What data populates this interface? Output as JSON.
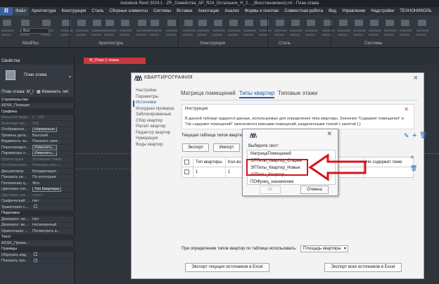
{
  "app": {
    "title": "Autodesk Revit 2024.1 - ZR_Семейства_АР_R24_Остальное_Н_2..._(Восстановлено).rvt - План этажа"
  },
  "menu": [
    "Файл",
    "Архитектура",
    "Конструкция",
    "Сталь",
    "Сборные элементы",
    "Системы",
    "Вставка",
    "Аннотации",
    "Анализ",
    "Формы и генплан",
    "Совместная работа",
    "Вид",
    "Управление",
    "Надстройки",
    "ТЕХНОНИКОЛЬ"
  ],
  "ribbon": {
    "panels": [
      "ModPlus",
      "Архитектура",
      "Конструкции",
      "Сталь",
      "Системы"
    ],
    "dropdown_value": "Все"
  },
  "view_tab": {
    "label": "М_План 1 этажа"
  },
  "left_panel": {
    "title": "Свойства",
    "type_name": "План этажа",
    "plan_selector": "План этажа: М_І",
    "edit_type_label": "Изменить тип",
    "rows": [
      {
        "k": "Строительство",
        "v": "",
        "hdr": true
      },
      {
        "k": "ADSK_Позиция",
        "v": ""
      },
      {
        "k": "Графика",
        "v": "",
        "hdr": true
      },
      {
        "k": "Масштаб вида",
        "v": "1 : 100"
      },
      {
        "k": "Значение ма...",
        "v": "100"
      },
      {
        "k": "Отображени...",
        "v": "Нормально",
        "box": true
      },
      {
        "k": "Уровень дета...",
        "v": "Высокий"
      },
      {
        "k": "Видимость ча...",
        "v": "Показать ориг..."
      },
      {
        "k": "Переопредел...",
        "v": "Изменить...",
        "box": true
      },
      {
        "k": "Параметры о...",
        "v": "Изменить...",
        "box": true
      },
      {
        "k": "Ориентация",
        "v": "Условный север"
      },
      {
        "k": "Отображение...",
        "v": "Очищать все с..."
      },
      {
        "k": "Дисциплина",
        "v": "Координация"
      },
      {
        "k": "Показать не...",
        "v": "По категории"
      },
      {
        "k": "Положение ц...",
        "v": "Фон"
      },
      {
        "k": "Цветовая схе...",
        "v": "Тип Квартиры",
        "box": true
      },
      {
        "k": "Цветовая схе...",
        "v": "<нет>"
      },
      {
        "k": "Графический ...",
        "v": "Нет"
      },
      {
        "k": "Траектория с...",
        "v": "",
        "cb": true
      },
      {
        "k": "Подложка",
        "v": "",
        "hdr": true
      },
      {
        "k": "Диапазон: ни...",
        "v": "Нет"
      },
      {
        "k": "Диапазон: ве...",
        "v": "Несвязанный"
      },
      {
        "k": "Ориентация ...",
        "v": "Посмотреть в..."
      },
      {
        "k": "Текст",
        "v": "",
        "hdr": true
      },
      {
        "k": "ADSK_Приме...",
        "v": ""
      },
      {
        "k": "Границы",
        "v": "",
        "hdr": true
      },
      {
        "k": "Обрезать вид",
        "v": "",
        "cb": true
      },
      {
        "k": "Показать гра...",
        "v": "",
        "cb": true
      }
    ]
  },
  "dialog": {
    "title": "КВАРТИРОГРАФИЯ",
    "nav": [
      "Настройки",
      "Параметры",
      "Источники",
      "Исходная проверка",
      "Заблокированные",
      "Сбор квартир",
      "Расчет квартир",
      "Редактор квартир",
      "Нумерация",
      "Виды квартир"
    ],
    "nav_selected": 2,
    "tabs": [
      "Матрица помещений",
      "Типы квартир",
      "Типовые этажи"
    ],
    "tab_selected": 1,
    "info_title": "Инструкция",
    "info_text": "В данной таблице задаются данные, используемые для определения типа квартиры. Значения \"Содержит помещения\" и \"Не содержит помещений\" заполняются именами помещений, разделенными точкой с запятой (;)",
    "current_label": "Текущая таблица типов квартир:",
    "export_btn": "Экспорт",
    "import_btn": "Импорт",
    "table": {
      "headers": [
        "Тип квартиры",
        "Кол-во",
        "",
        "Не содержит поме"
      ],
      "row": [
        "1",
        "1"
      ]
    },
    "bottom_label": "При определении типов квартир по таблице использовать:",
    "bottom_combo": "Площадь квартиры",
    "export_current_btn": "Экспорт текущих источников в Excel",
    "export_all_btn": "Экспорт всех источников в Excel"
  },
  "popup": {
    "label": "Выберите лист:",
    "items": [
      "МатрицаПомещений",
      "ЭПТипы_Квартир_Старые",
      "ЭПТипы_Квартир_Новые",
      "АРТипы_Квартир",
      "ПОФункц_назначение"
    ],
    "ok_btn": "Ок",
    "cancel_btn": "Отмена"
  },
  "colors": {
    "accent": "#1f5fa8",
    "highlight": "#d4141c"
  }
}
